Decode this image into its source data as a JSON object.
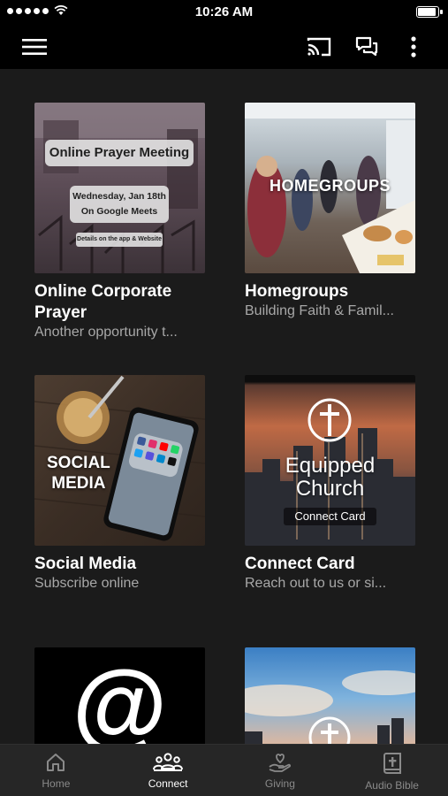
{
  "status": {
    "time": "10:26 AM"
  },
  "appbar": {
    "menu_icon": "hamburger-menu-icon",
    "cast_icon": "cast-icon",
    "chat_icon": "chat-icon",
    "more_icon": "more-vertical-icon"
  },
  "cards": [
    {
      "title": "Online Corporate Prayer",
      "subtitle": "Another opportunity t...",
      "image": {
        "heading": "Online Prayer Meeting",
        "date": "Wednesday, Jan 18th",
        "platform": "On Google Meets",
        "note": "Details on the app & Website"
      }
    },
    {
      "title": "Homegroups",
      "subtitle": "Building Faith & Famil...",
      "image": {
        "overlay": "HOMEGROUPS"
      }
    },
    {
      "title": "Social Media",
      "subtitle": "Subscribe online",
      "image": {
        "line1": "SOCIAL",
        "line2": "MEDIA"
      }
    },
    {
      "title": "Connect Card",
      "subtitle": "Reach out to us or si...",
      "image": {
        "line1": "Equipped",
        "line2": "Church",
        "caption": "Connect Card"
      }
    },
    {
      "image": {
        "symbol": "@"
      }
    },
    {
      "image": {}
    }
  ],
  "tabs": [
    {
      "label": "Home",
      "icon": "home-icon"
    },
    {
      "label": "Connect",
      "icon": "people-icon",
      "active": true
    },
    {
      "label": "Giving",
      "icon": "giving-hand-heart-icon"
    },
    {
      "label": "Audio Bible",
      "icon": "bible-icon"
    }
  ],
  "colors": {
    "background": "#1b1b1b",
    "bar": "#000000",
    "tabbar": "#262626",
    "subtitle": "#a8a8a8"
  }
}
